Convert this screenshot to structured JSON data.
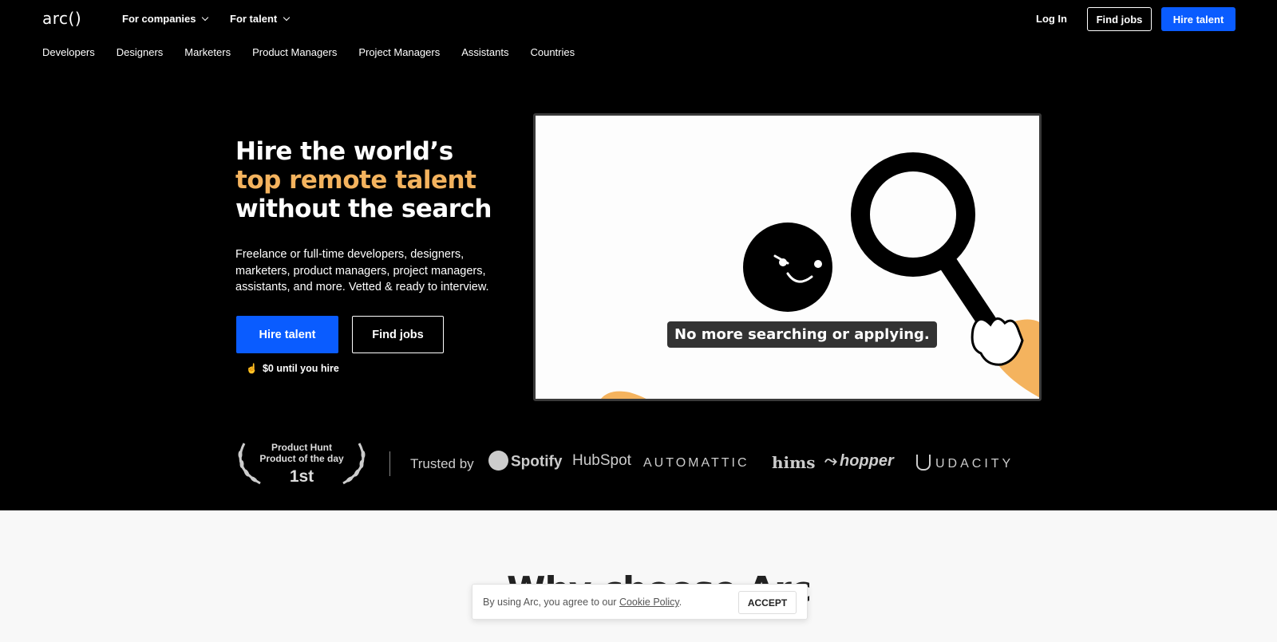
{
  "header": {
    "logo": "arc()",
    "menus": [
      {
        "label": "For companies"
      },
      {
        "label": "For talent"
      }
    ],
    "login": "Log In",
    "find_jobs": "Find jobs",
    "hire_talent": "Hire talent"
  },
  "subnav": [
    "Developers",
    "Designers",
    "Marketers",
    "Product Managers",
    "Project Managers",
    "Assistants",
    "Countries"
  ],
  "hero": {
    "title_line1": "Hire the world’s",
    "title_line2": "top remote talent",
    "title_line3": "without the search",
    "description": "Freelance or full-time developers, designers, marketers, product managers, project managers, assistants, and more. Vetted & ready to interview.",
    "primary_button": "Hire talent",
    "secondary_button": "Find jobs",
    "note": "$0 until you hire",
    "accent_color": "#f4b35e",
    "brand_blue": "#0a5cff"
  },
  "video": {
    "caption": "No more searching or applying."
  },
  "trusted": {
    "badge_line1": "Product Hunt",
    "badge_line2": "Product of the day",
    "badge_rank": "1st",
    "label": "Trusted by",
    "brands": [
      "Spotify",
      "HubSpot",
      "AUTOMATTIC",
      "hims",
      "hopper",
      "UDACITY"
    ]
  },
  "section": {
    "heading": "Why choose Arc"
  },
  "cookie": {
    "text_before": "By using Arc, you agree to our ",
    "link": "Cookie Policy",
    "text_after": ".",
    "accept": "ACCEPT"
  }
}
